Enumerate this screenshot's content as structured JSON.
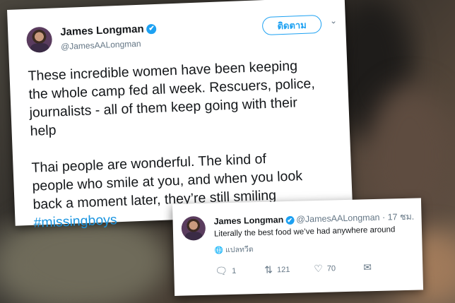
{
  "main_tweet": {
    "author_name": "James Longman",
    "author_handle": "@JamesAALongman",
    "verified_icon": "✔",
    "follow_label": "ติดตาม",
    "chevron_icon": "chevron-down",
    "text_lines": [
      "These incredible women have been keeping",
      "the whole camp fed all week. Rescuers, police,",
      "journalists - all of them keep going with their",
      "help"
    ],
    "text_lines_2": [
      "Thai people are wonderful. The kind of",
      "people who smile at you, and when you look",
      "back a moment later, they’re still smiling"
    ],
    "hashtag": "#missingboys"
  },
  "reply_tweet": {
    "author_name": "James Longman",
    "verified_icon": "✔",
    "author_handle": "@JamesAALongman",
    "timestamp": "· 17 ชม.",
    "text": "Literally the best food we’ve had anywhere around",
    "translate_label": "แปลทวีต",
    "reply_count": "1",
    "retweet_count": "121",
    "like_count": "70"
  },
  "colors": {
    "accent": "#1da1f2",
    "text": "#14171a",
    "muted": "#657786"
  }
}
